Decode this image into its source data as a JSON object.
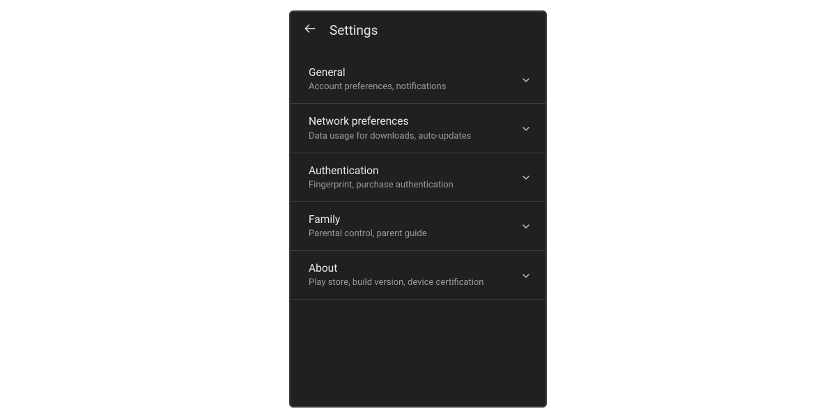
{
  "header": {
    "title": "Settings"
  },
  "items": [
    {
      "title": "General",
      "subtitle": "Account preferences, notifications"
    },
    {
      "title": "Network preferences",
      "subtitle": "Data usage for downloads, auto-updates"
    },
    {
      "title": "Authentication",
      "subtitle": "Fingerprint, purchase authentication"
    },
    {
      "title": "Family",
      "subtitle": "Parental control, parent guide"
    },
    {
      "title": "About",
      "subtitle": "Play store, build version, device certification"
    }
  ]
}
